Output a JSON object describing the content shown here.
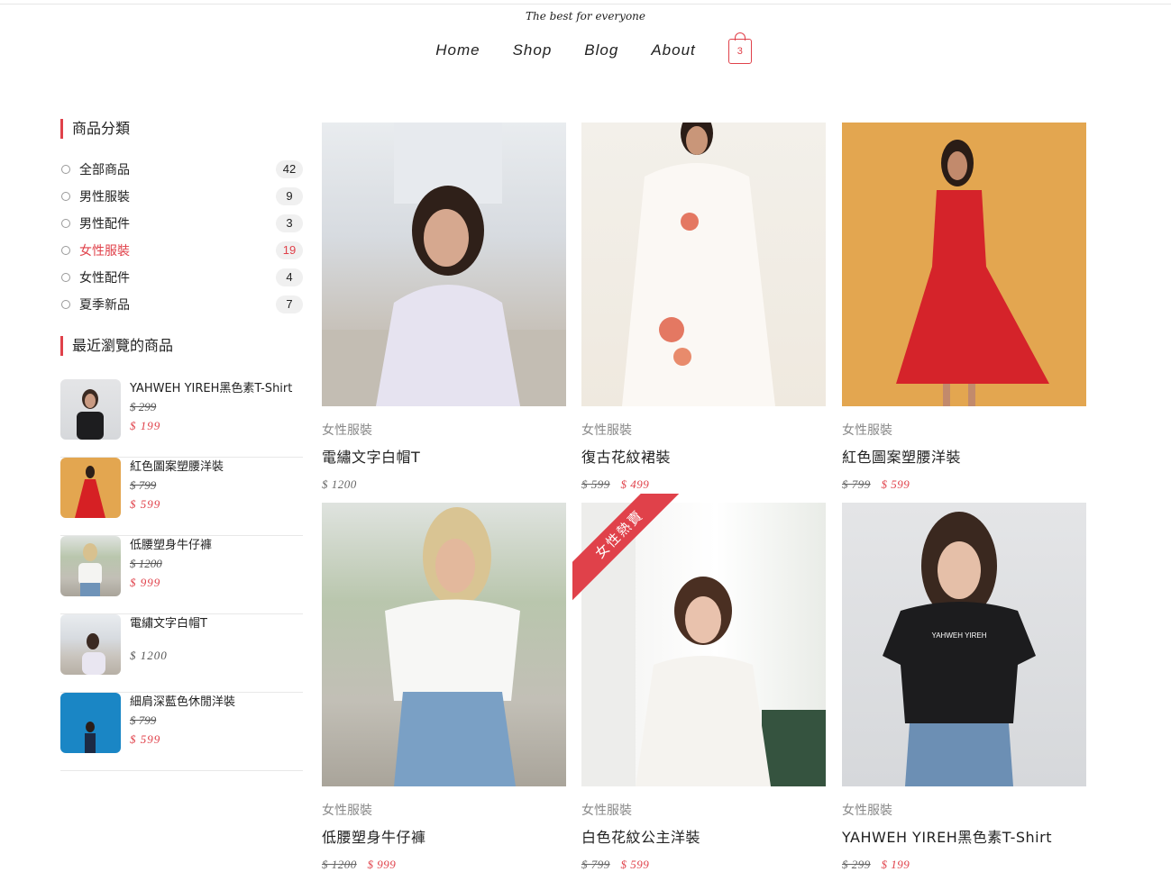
{
  "tagline": "The best for everyone",
  "nav": {
    "home": "Home",
    "shop": "Shop",
    "blog": "Blog",
    "about": "About",
    "cart_count": "3"
  },
  "colors": {
    "accent": "#e0414a"
  },
  "sidebar": {
    "categories_title": "商品分類",
    "categories": [
      {
        "label": "全部商品",
        "count": "42"
      },
      {
        "label": "男性服裝",
        "count": "9"
      },
      {
        "label": "男性配件",
        "count": "3"
      },
      {
        "label": "女性服裝",
        "count": "19"
      },
      {
        "label": "女性配件",
        "count": "4"
      },
      {
        "label": "夏季新品",
        "count": "7"
      }
    ],
    "recent_title": "最近瀏覽的商品",
    "recent": [
      {
        "name": "YAHWEH YIREH黑色素T-Shirt",
        "old": "$ 299",
        "new": "$ 199"
      },
      {
        "name": "紅色圖案塑腰洋裝",
        "old": "$ 799",
        "new": "$ 599"
      },
      {
        "name": "低腰塑身牛仔褲",
        "old": "$ 1200",
        "new": "$ 999"
      },
      {
        "name": "電繡文字白帽T",
        "price": "$ 1200"
      },
      {
        "name": "細肩深藍色休閒洋裝",
        "old": "$ 799",
        "new": "$ 599"
      }
    ]
  },
  "products": [
    {
      "category": "女性服裝",
      "name": "電繡文字白帽T",
      "price": "$ 1200"
    },
    {
      "category": "女性服裝",
      "name": "復古花紋裙裝",
      "old": "$ 599",
      "new": "$ 499"
    },
    {
      "category": "女性服裝",
      "name": "紅色圖案塑腰洋裝",
      "old": "$ 799",
      "new": "$ 599"
    },
    {
      "category": "女性服裝",
      "name": "低腰塑身牛仔褲",
      "old": "$ 1200",
      "new": "$ 999"
    },
    {
      "category": "女性服裝",
      "name": "白色花紋公主洋裝",
      "old": "$ 799",
      "new": "$ 599",
      "ribbon": "女性熱賣"
    },
    {
      "category": "女性服裝",
      "name": "YAHWEH YIREH黑色素T-Shirt",
      "old": "$ 299",
      "new": "$ 199"
    }
  ]
}
